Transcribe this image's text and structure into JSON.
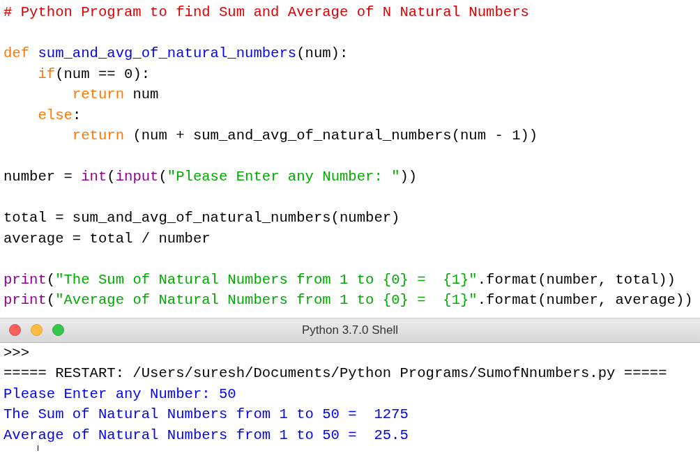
{
  "editor": {
    "lines": [
      {
        "kind": "code",
        "tokens": [
          {
            "kind": "comment",
            "text": "# Python Program to find Sum and Average of N Natural Numbers"
          }
        ]
      },
      {
        "kind": "blank"
      },
      {
        "kind": "code",
        "tokens": [
          {
            "kind": "keyword",
            "text": "def"
          },
          {
            "kind": "definition",
            "text": " sum_and_avg_of_natural_numbers"
          },
          {
            "kind": "plain",
            "text": "(num):"
          }
        ]
      },
      {
        "kind": "code",
        "tokens": [
          {
            "kind": "keyword",
            "text": "    if"
          },
          {
            "kind": "plain",
            "text": "(num == 0):"
          }
        ]
      },
      {
        "kind": "code",
        "tokens": [
          {
            "kind": "keyword",
            "text": "        return"
          },
          {
            "kind": "plain",
            "text": " num"
          }
        ]
      },
      {
        "kind": "code",
        "tokens": [
          {
            "kind": "keyword",
            "text": "    else"
          },
          {
            "kind": "plain",
            "text": ":"
          }
        ]
      },
      {
        "kind": "code",
        "tokens": [
          {
            "kind": "keyword",
            "text": "        return"
          },
          {
            "kind": "plain",
            "text": " (num + sum_and_avg_of_natural_numbers(num - 1))"
          }
        ]
      },
      {
        "kind": "blank"
      },
      {
        "kind": "code",
        "tokens": [
          {
            "kind": "plain",
            "text": "number = "
          },
          {
            "kind": "builtin",
            "text": "int"
          },
          {
            "kind": "plain",
            "text": "("
          },
          {
            "kind": "builtin",
            "text": "input"
          },
          {
            "kind": "plain",
            "text": "("
          },
          {
            "kind": "string",
            "text": "\"Please Enter any Number: \""
          },
          {
            "kind": "plain",
            "text": "))"
          }
        ]
      },
      {
        "kind": "blank"
      },
      {
        "kind": "code",
        "tokens": [
          {
            "kind": "plain",
            "text": "total = sum_and_avg_of_natural_numbers(number)"
          }
        ]
      },
      {
        "kind": "code",
        "tokens": [
          {
            "kind": "plain",
            "text": "average = total / number"
          }
        ]
      },
      {
        "kind": "blank"
      },
      {
        "kind": "code",
        "tokens": [
          {
            "kind": "builtin",
            "text": "print"
          },
          {
            "kind": "plain",
            "text": "("
          },
          {
            "kind": "string",
            "text": "\"The Sum of Natural Numbers from 1 to {0} =  {1}\""
          },
          {
            "kind": "plain",
            "text": ".format(number, total))"
          }
        ]
      },
      {
        "kind": "code",
        "tokens": [
          {
            "kind": "builtin",
            "text": "print"
          },
          {
            "kind": "plain",
            "text": "("
          },
          {
            "kind": "string",
            "text": "\"Average of Natural Numbers from 1 to {0} =  {1}\""
          },
          {
            "kind": "plain",
            "text": ".format(number, average))"
          }
        ]
      }
    ]
  },
  "shell": {
    "title": "Python 3.7.0 Shell",
    "lines": [
      {
        "kind": "prompt",
        "text": ">>>"
      },
      {
        "kind": "plain",
        "text": "===== RESTART: /Users/suresh/Documents/Python Programs/SumofNnumbers.py ====="
      },
      {
        "kind": "output",
        "text": "Please Enter any Number: 50"
      },
      {
        "kind": "output",
        "text": "The Sum of Natural Numbers from 1 to 50 =  1275"
      },
      {
        "kind": "output",
        "text": "Average of Natural Numbers from 1 to 50 =  25.5"
      }
    ]
  }
}
